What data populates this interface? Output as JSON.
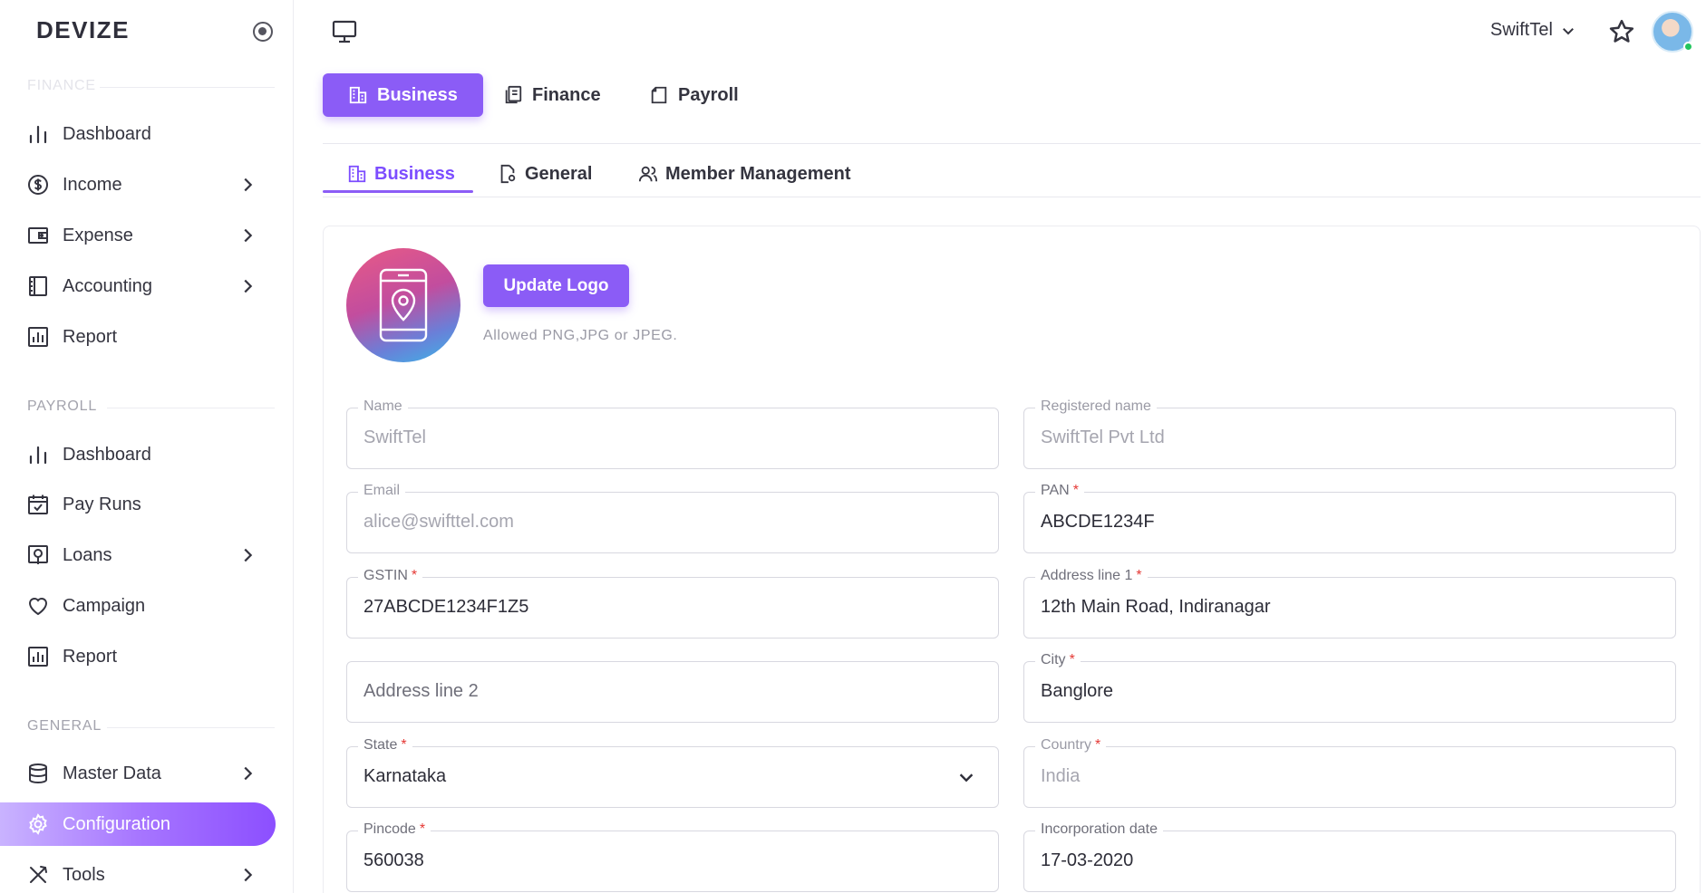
{
  "app": {
    "brand": "DEVIZE"
  },
  "sidebar": {
    "finance_section": "FINANCE",
    "finance_items": [
      {
        "label": "Dashboard",
        "icon": "bar-chart-icon"
      },
      {
        "label": "Income",
        "icon": "dollar-circle-icon"
      },
      {
        "label": "Expense",
        "icon": "wallet-icon"
      },
      {
        "label": "Accounting",
        "icon": "ledger-icon"
      },
      {
        "label": "Report",
        "icon": "report-icon"
      }
    ],
    "payroll_section": "PAYROLL",
    "payroll_items": [
      {
        "label": "Dashboard",
        "icon": "bar-chart-icon"
      },
      {
        "label": "Pay Runs",
        "icon": "calendar-icon"
      },
      {
        "label": "Loans",
        "icon": "loan-icon"
      },
      {
        "label": "Campaign",
        "icon": "heart-icon"
      },
      {
        "label": "Report",
        "icon": "report-icon"
      }
    ],
    "general_section": "GENERAL",
    "general_items": [
      {
        "label": "Master Data",
        "icon": "database-icon"
      },
      {
        "label": "Configuration",
        "icon": "gear-icon",
        "active": true
      },
      {
        "label": "Tools",
        "icon": "tools-icon"
      }
    ]
  },
  "topbar": {
    "company": "SwiftTel"
  },
  "primary_tabs": [
    {
      "label": "Business",
      "active": true
    },
    {
      "label": "Finance"
    },
    {
      "label": "Payroll"
    }
  ],
  "secondary_tabs": [
    {
      "label": "Business",
      "active": true
    },
    {
      "label": "General"
    },
    {
      "label": "Member Management"
    }
  ],
  "logo_section": {
    "button": "Update Logo",
    "hint": "Allowed PNG,JPG or JPEG."
  },
  "form": {
    "name": {
      "label": "Name",
      "value": "SwiftTel"
    },
    "registered_name": {
      "label": "Registered name",
      "value": "SwiftTel Pvt Ltd"
    },
    "email": {
      "label": "Email",
      "value": "alice@swifttel.com"
    },
    "pan": {
      "label": "PAN",
      "value": "ABCDE1234F"
    },
    "gstin": {
      "label": "GSTIN",
      "value": "27ABCDE1234F1Z5"
    },
    "address1": {
      "label": "Address line 1",
      "value": "12th Main Road, Indiranagar"
    },
    "address2": {
      "placeholder": "Address line 2"
    },
    "city": {
      "label": "City",
      "value": "Banglore"
    },
    "state": {
      "label": "State",
      "value": "Karnataka"
    },
    "country": {
      "label": "Country",
      "value": "India"
    },
    "pincode": {
      "label": "Pincode",
      "value": "560038"
    },
    "incorporation": {
      "label": "Incorporation date",
      "value": "17-03-2020"
    },
    "required_mark": "*"
  },
  "colors": {
    "accent": "#8b5cf6",
    "required": "#e53935",
    "online": "#22c55e"
  }
}
